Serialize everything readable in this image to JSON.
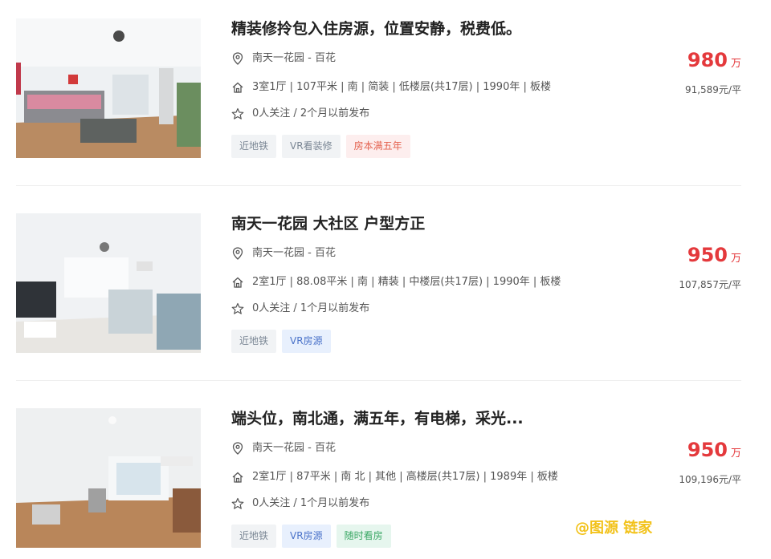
{
  "listings": [
    {
      "title": "精装修拎包入住房源，位置安静，税费低。",
      "location": "南天一花园 - 百花",
      "info": "3室1厅 | 107平米 | 南 | 简装 | 低楼层(共17层) | 1990年 | 板楼",
      "follow": "0人关注 / 2个月以前发布",
      "tags": [
        "近地铁",
        "VR看装修",
        "房本满五年"
      ],
      "price": "980",
      "price_unit": "万",
      "unit_price": "91,589元/平"
    },
    {
      "title": "南天一花园 大社区 户型方正",
      "location": "南天一花园 - 百花",
      "info": "2室1厅 | 88.08平米 | 南 | 精装 | 中楼层(共17层) | 1990年 | 板楼",
      "follow": "0人关注 / 1个月以前发布",
      "tags": [
        "近地铁",
        "VR房源"
      ],
      "price": "950",
      "price_unit": "万",
      "unit_price": "107,857元/平"
    },
    {
      "title": "端头位，南北通，满五年，有电梯，采光...",
      "location": "南天一花园 - 百花",
      "info": "2室1厅 | 87平米 | 南 北 | 其他 | 高楼层(共17层) | 1989年 | 板楼",
      "follow": "0人关注 / 1个月以前发布",
      "tags": [
        "近地铁",
        "VR房源",
        "随时看房"
      ],
      "price": "950",
      "price_unit": "万",
      "unit_price": "109,196元/平"
    }
  ],
  "watermark": "@图源 链家",
  "colors": {
    "price": "#e4393c",
    "tag_gray_bg": "#f1f3f5",
    "tag_blue_bg": "#e8f0fd",
    "tag_red_bg": "#fdeeee",
    "tag_green_bg": "#e6f6ee",
    "watermark": "#f2c21a"
  },
  "icons": {
    "location": "location-pin-icon",
    "info": "house-icon",
    "follow": "star-icon"
  }
}
